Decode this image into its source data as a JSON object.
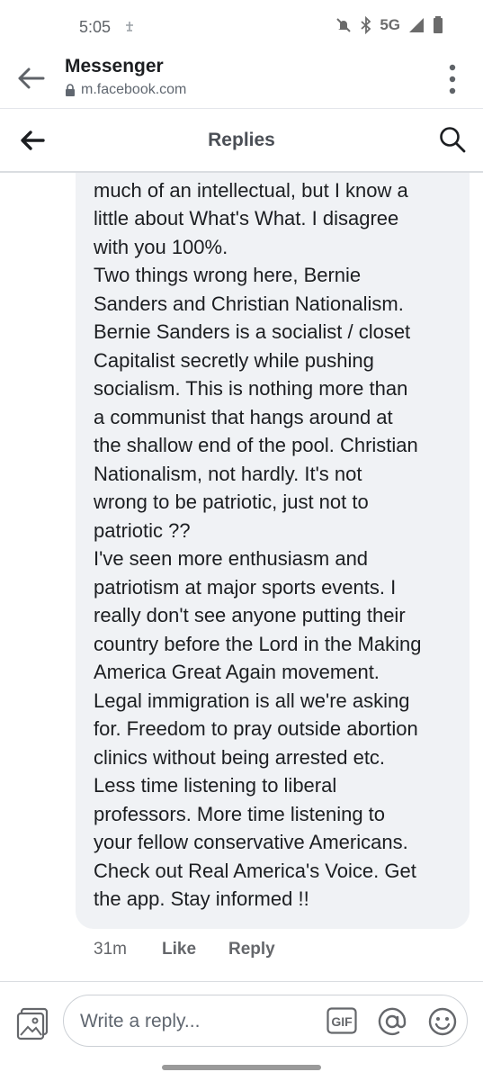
{
  "status_bar": {
    "time": "5:05",
    "network": "5G",
    "icons": [
      "notification-icon",
      "mute-icon",
      "bluetooth-icon",
      "signal-icon",
      "battery-icon"
    ]
  },
  "browser": {
    "title": "Messenger",
    "url": "m.facebook.com",
    "icons": [
      "back-arrow-icon",
      "lock-icon",
      "more-vert-icon"
    ]
  },
  "replies_header": {
    "title": "Replies",
    "icons": [
      "back-arrow-icon",
      "search-icon"
    ]
  },
  "comment": {
    "text": "I'm your uncle and I love you. I'm not\nmuch of an intellectual, but I know a\nlittle about What's What. I disagree\nwith you 100%.\nTwo things wrong here, Bernie\nSanders and Christian Nationalism.\nBernie Sanders is a socialist / closet\nCapitalist secretly while pushing\nsocialism. This is nothing more than\na communist that hangs around at\nthe shallow end of the pool. Christian\nNationalism, not hardly. It's not\nwrong to be patriotic, just not to\npatriotic ??\nI've seen more enthusiasm and\npatriotism at major sports events. I\nreally don't see anyone putting their\ncountry before the Lord in the Making\nAmerica Great Again movement.\nLegal immigration is all we're asking\nfor. Freedom to pray outside abortion\nclinics without being arrested etc.\nLess time listening to liberal\nprofessors. More time listening to\nyour fellow conservative Americans.\nCheck out Real America's Voice. Get\nthe app. Stay informed !!",
    "time": "31m",
    "like_label": "Like",
    "reply_label": "Reply"
  },
  "composer": {
    "placeholder": "Write a reply...",
    "gif_label": "GIF",
    "icons": [
      "photo-icon",
      "gif-icon",
      "mention-icon",
      "emoji-icon"
    ]
  },
  "colors": {
    "bubble": "#f0f2f5",
    "text": "#1c1e21",
    "secondary": "#65676b"
  }
}
